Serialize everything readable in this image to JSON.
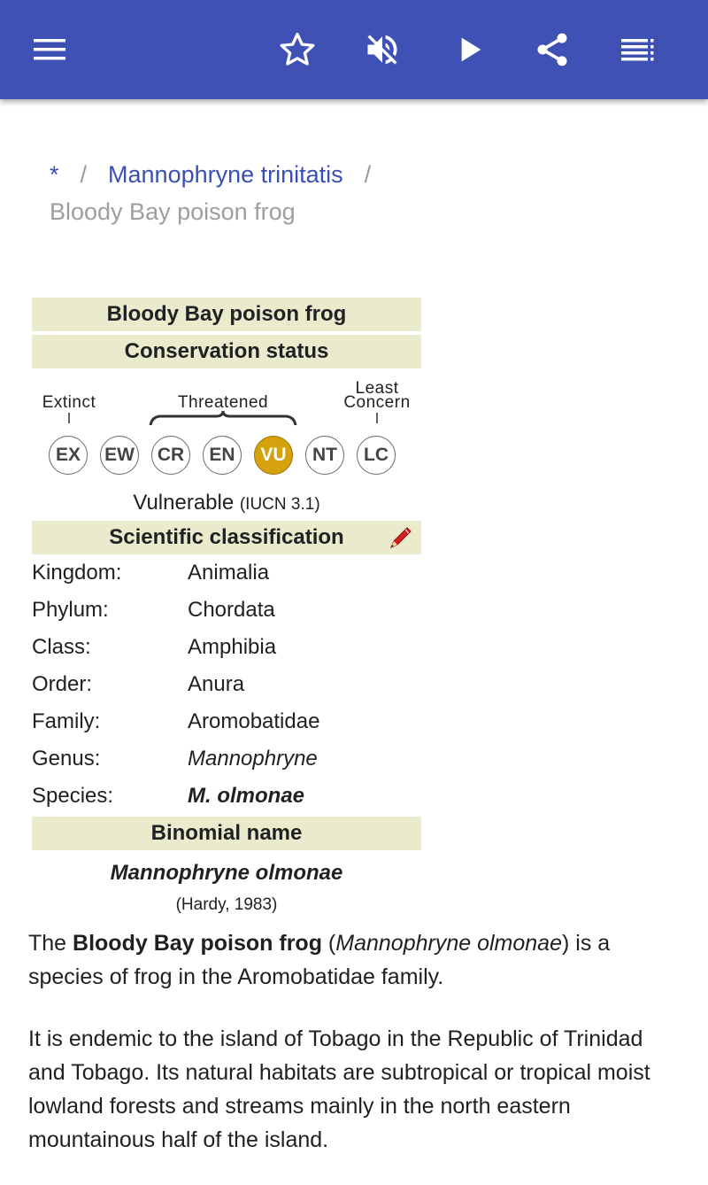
{
  "appbar": {
    "color": "#3f51b5",
    "icons": [
      "menu-icon",
      "star-outline-icon",
      "volume-off-icon",
      "play-icon",
      "share-icon",
      "playlist-icon"
    ]
  },
  "breadcrumb": {
    "home": "*",
    "separator": "/",
    "parent": "Mannophryne trinitatis",
    "current": "Bloody Bay poison frog"
  },
  "infobox": {
    "title": "Bloody Bay poison frog",
    "conservation_heading": "Conservation status",
    "scale": {
      "extinct_label": "Extinct",
      "threatened_label": "Threatened",
      "least_label_line1": "Least",
      "least_label_line2": "Concern",
      "codes": [
        "EX",
        "EW",
        "CR",
        "EN",
        "VU",
        "NT",
        "LC"
      ],
      "active": "VU",
      "active_color": "#d5a10d"
    },
    "status": "Vulnerable",
    "status_source": "(IUCN 3.1)",
    "classification_heading": "Scientific classification",
    "classification": [
      {
        "rank": "Kingdom:",
        "value": "Animalia"
      },
      {
        "rank": "Phylum:",
        "value": "Chordata"
      },
      {
        "rank": "Class:",
        "value": "Amphibia"
      },
      {
        "rank": "Order:",
        "value": "Anura"
      },
      {
        "rank": "Family:",
        "value": "Aromobatidae"
      },
      {
        "rank": "Genus:",
        "value": "Mannophryne"
      },
      {
        "rank": "Species:",
        "value": "M. olmonae"
      }
    ],
    "binomial_heading": "Binomial name",
    "binomial": "Mannophryne olmonae",
    "authority": "(Hardy, 1983)",
    "header_bg": "#eaeacd"
  },
  "article": {
    "p1_a": "The ",
    "p1_b": "Bloody Bay poison frog",
    "p1_c": " (",
    "p1_d": "Mannophryne olmonae",
    "p1_e": ") is a species of frog in the Aromobatidae family.",
    "p2": "It is endemic to the island of Tobago in the Republic of Trinidad and Tobago. Its natural habitats are subtropical or tropical moist lowland forests and streams mainly in the north eastern mountainous half of the island."
  }
}
